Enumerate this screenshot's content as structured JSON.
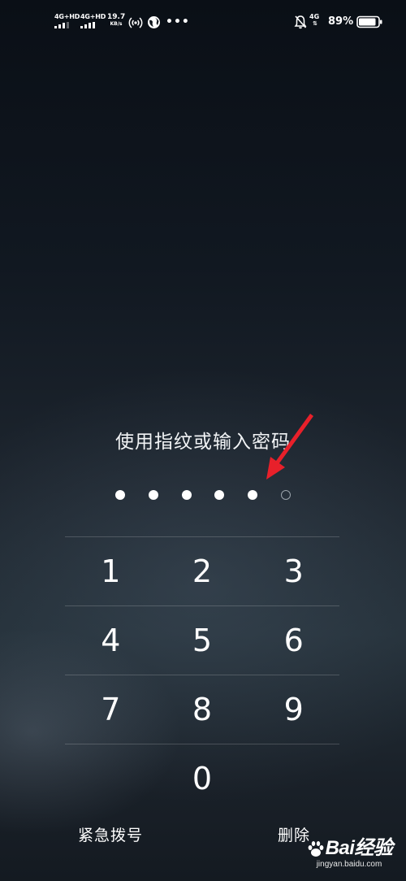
{
  "status_bar": {
    "sim1_network": "4G+HD",
    "sim2_network": "4G+HD",
    "data_speed_value": "19.7",
    "data_speed_unit": "KB/s",
    "more_dots": "•••",
    "data_network": "4G",
    "data_arrows": "⇅",
    "battery_percent": "89%",
    "battery_level": 0.89
  },
  "lock_screen": {
    "prompt": "使用指纹或输入密码",
    "pin_length": 6,
    "pin_entered": 5,
    "keys": [
      [
        "1",
        "2",
        "3"
      ],
      [
        "4",
        "5",
        "6"
      ],
      [
        "7",
        "8",
        "9"
      ],
      [
        "0"
      ]
    ],
    "emergency_label": "紧急拨号",
    "delete_label": "删除"
  },
  "watermark": {
    "logo_text": "Bai经验",
    "site": "jingyan.baidu.com"
  },
  "colors": {
    "annotation_red": "#e8202a",
    "text": "#ffffff",
    "divider": "rgba(255,255,255,0.18)"
  }
}
